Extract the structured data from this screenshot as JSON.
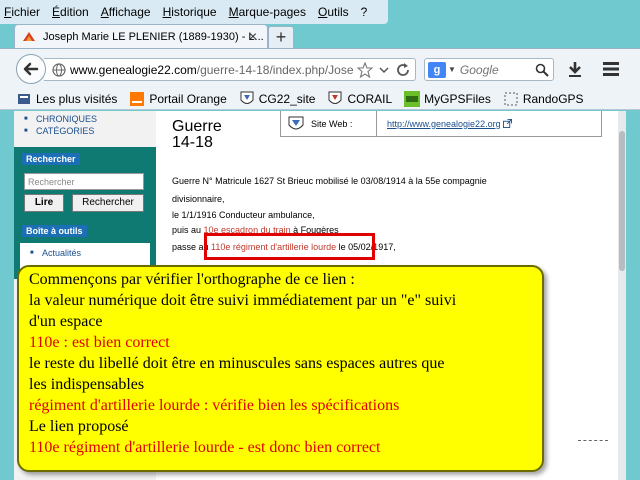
{
  "menu": {
    "items": [
      "Fichier",
      "Édition",
      "Affichage",
      "Historique",
      "Marque-pages",
      "Outils",
      "?"
    ]
  },
  "tab": {
    "title": "Joseph Marie LE PLENIER (1889-1930) - L...",
    "close": "×",
    "new_tab": "+"
  },
  "navbar": {
    "url_host": "www.genealogie22.com",
    "url_path": "/guerre-14-18/index.php/Jose",
    "search_placeholder": "Google"
  },
  "bookmarks": [
    {
      "label": "Les plus visités",
      "icon": "bookmarks-icon"
    },
    {
      "label": "Portail Orange",
      "icon": "orange-icon"
    },
    {
      "label": "CG22_site",
      "icon": "crest-icon"
    },
    {
      "label": "CORAIL",
      "icon": "crest-icon"
    },
    {
      "label": "MyGPSFiles",
      "icon": "gps-icon"
    },
    {
      "label": "RandoGPS",
      "icon": "dotted-icon"
    }
  ],
  "sidebar": {
    "links_top": [
      "CHRONIQUES",
      "CATÉGORIES"
    ],
    "search_title": "Rechercher",
    "search_placeholder": "Rechercher",
    "read_button": "Lire",
    "search_button": "Rechercher",
    "tools_title": "Boîte à outils",
    "tools_links": [
      "Actualités"
    ]
  },
  "main": {
    "title_line1": "Guerre",
    "title_line2": "14-18",
    "website_label": "Site Web :",
    "website_url": "http://www.genealogie22.org",
    "bio": {
      "line1": "Guerre N° Matricule 1627 St Brieuc mobilisé le 03/08/1914 à la 55e compagnie",
      "line2": "divisionnaire,",
      "line3": "le 1/1/1916 Conducteur ambulance,",
      "line4_pre": "puis au ",
      "line4_link": "10e escadron du train",
      "line4_post": " à Fougères",
      "line5_pre": "passe au ",
      "line5_link": "110e régiment d'artillerie lourde",
      "line5_post": " le 05/02/1917,"
    }
  },
  "callout": {
    "line1": "Commençons par vérifier l'orthographe de ce lien :",
    "line2": "la valeur numérique doit être suivi immédiatement par un \"e\" suivi",
    "line3": "d'un espace",
    "line4": "110e : est bien correct",
    "line5": "le reste du libellé doit être en minuscules sans espaces autres que",
    "line6": "les indispensables",
    "line7": "régiment d'artillerie lourde : vérifie bien les spécifications",
    "line8": "Le lien proposé",
    "line9": "110e régiment d'artillerie lourde - est donc bien correct"
  },
  "colors": {
    "callout_bg": "#ffff00",
    "callout_red": "#e00000",
    "highlight_border": "#e00000",
    "panel_green": "#0f7a72",
    "panel_title_blue": "#1c6fb5",
    "desktop_teal": "#6fc9cf"
  }
}
